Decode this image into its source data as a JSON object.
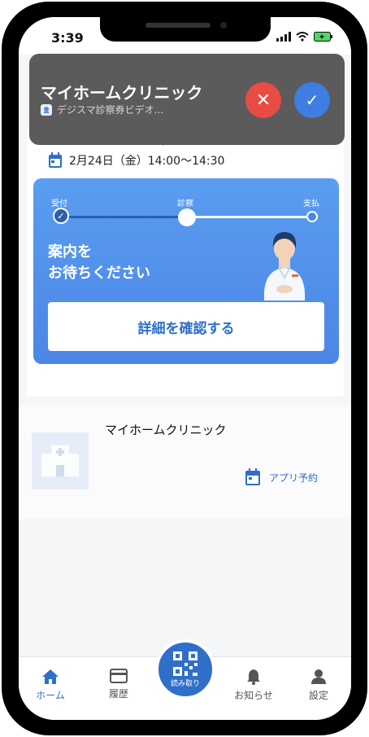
{
  "status_bar": {
    "time": "3:39"
  },
  "notification": {
    "title": "マイホームクリニック",
    "subtitle": "デジスマ診察券ビデオ...",
    "reject_icon": "close-icon",
    "accept_icon": "check-icon"
  },
  "reservation": {
    "clinic_name": "マイホームクリニック",
    "datetime": "2月24日（金）14:00〜14:30",
    "steps": [
      "受付",
      "診察",
      "支払"
    ],
    "current_step_index": 1,
    "status_message": "案内を\nお待ちください",
    "detail_button": "詳細を確認する"
  },
  "clinic_card": {
    "name": "マイホームクリニック",
    "booking_label": "アプリ予約"
  },
  "tabbar": {
    "home": "ホーム",
    "history": "履歴",
    "scan": "読み取り",
    "notifications": "お知らせ",
    "settings": "設定"
  },
  "colors": {
    "accent": "#2f6fc9",
    "progress_gradient_top": "#5a9df0",
    "reject": "#e74c45",
    "accept": "#3e7de2"
  }
}
